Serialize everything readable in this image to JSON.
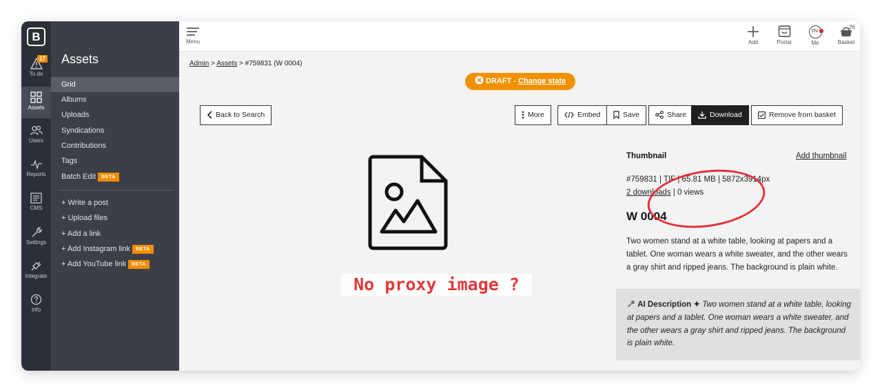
{
  "rail": {
    "todo_badge": "27",
    "items": [
      {
        "label": "To do",
        "icon": "warning-icon"
      },
      {
        "label": "Assets",
        "icon": "grid-icon"
      },
      {
        "label": "Users",
        "icon": "users-icon"
      },
      {
        "label": "Reports",
        "icon": "pulse-icon"
      },
      {
        "label": "CMS",
        "icon": "cms-icon"
      },
      {
        "label": "Settings",
        "icon": "wrench-icon"
      },
      {
        "label": "Integrate",
        "icon": "plug-icon"
      },
      {
        "label": "Info",
        "icon": "question-icon"
      }
    ]
  },
  "subnav": {
    "title": "Assets",
    "items": [
      "Grid",
      "Albums",
      "Uploads",
      "Syndications",
      "Contributions",
      "Tags",
      "Batch Edit"
    ],
    "beta_label": "BETA",
    "actions": [
      "+ Write a post",
      "+ Upload files",
      "+ Add a link",
      "+ Add Instagram link",
      "+ Add YouTube link"
    ]
  },
  "topbar": {
    "menu_label": "Menu",
    "add_label": "Add",
    "portal_label": "Portal",
    "me_label": "Me",
    "me_initials": "DV",
    "basket_label": "Basket",
    "basket_count": "26"
  },
  "breadcrumb": {
    "admin": "Admin",
    "sep": ">",
    "assets": "Assets",
    "current": "#759831 (W 0004)"
  },
  "draft": {
    "state": "DRAFT",
    "dash": "-",
    "change_label": "Change state"
  },
  "toolbar": {
    "back": "Back to Search",
    "more": "More",
    "embed": "Embed",
    "save": "Save",
    "share": "Share",
    "download": "Download",
    "remove": "Remove from basket"
  },
  "preview": {
    "overlay_text": "No proxy image ?"
  },
  "asset": {
    "thumbnail_label": "Thumbnail",
    "add_thumbnail": "Add thumbnail",
    "meta": "#759831 | TIF | 65.81 MB | 5872x3914px",
    "downloads": "2 downloads",
    "views": "| 0 views",
    "title": "W 0004",
    "description": "Two women stand at a white table, looking at papers and a tablet. One woman wears a white sweater, and the other wears a gray shirt and ripped jeans. The background is plain white.",
    "ai_label": "AI Description ✦",
    "ai_description": "Two women stand at a white table, looking at papers and a tablet. One woman wears a white sweater, and the other wears a gray shirt and ripped jeans. The background is plain white."
  },
  "colors": {
    "accent": "#f29100",
    "annotation": "#e5303a",
    "rail": "#2c2f36",
    "subnav": "#3c3f47"
  }
}
